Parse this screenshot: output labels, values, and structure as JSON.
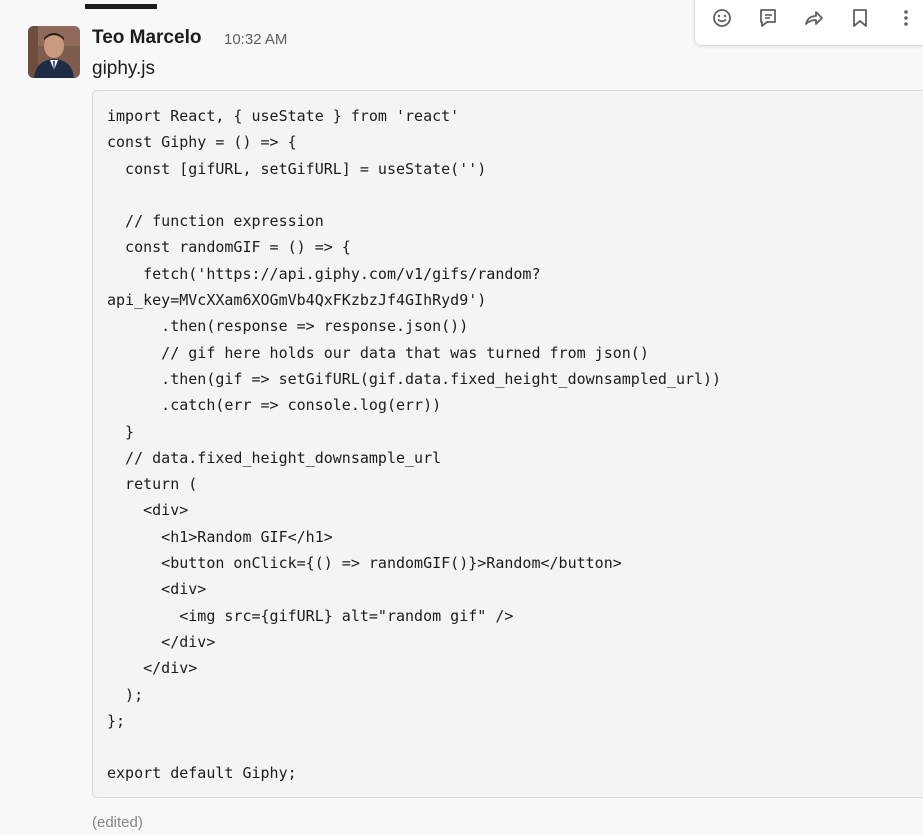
{
  "message": {
    "sender_name": "Teo Marcelo",
    "timestamp": "10:32 AM",
    "file_name": "giphy.js",
    "edited_label": "(edited)",
    "code_lines": [
      "import React, { useState } from 'react'",
      "const Giphy = () => {",
      "  const [gifURL, setGifURL] = useState('')",
      "",
      "  // function expression",
      "  const randomGIF = () => {",
      "    fetch('https://api.giphy.com/v1/gifs/random?",
      "api_key=MVcXXam6XOGmVb4QxFKzbzJf4GIhRyd9')",
      "      .then(response => response.json())",
      "      // gif here holds our data that was turned from json()",
      "      .then(gif => setGifURL(gif.data.fixed_height_downsampled_url))",
      "      .catch(err => console.log(err))",
      "  }",
      "  // data.fixed_height_downsample_url",
      "  return (",
      "    <div>",
      "      <h1>Random GIF</h1>",
      "      <button onClick={() => randomGIF()}>Random</button>",
      "      <div>",
      "        <img src={gifURL} alt=\"random gif\" />",
      "      </div>",
      "    </div>",
      "  );",
      "};",
      "",
      "export default Giphy;"
    ]
  },
  "toolbar": {
    "icons": [
      "emoji-reaction-icon",
      "reply-thread-icon",
      "share-message-icon",
      "bookmark-icon",
      "more-actions-icon"
    ]
  },
  "colors": {
    "background": "#f8f8f8",
    "code_background": "#f4f4f4",
    "code_border": "#d9d9d9",
    "text": "#1d1c1d",
    "muted_text": "#616061",
    "toolbar_icon": "#616061"
  }
}
